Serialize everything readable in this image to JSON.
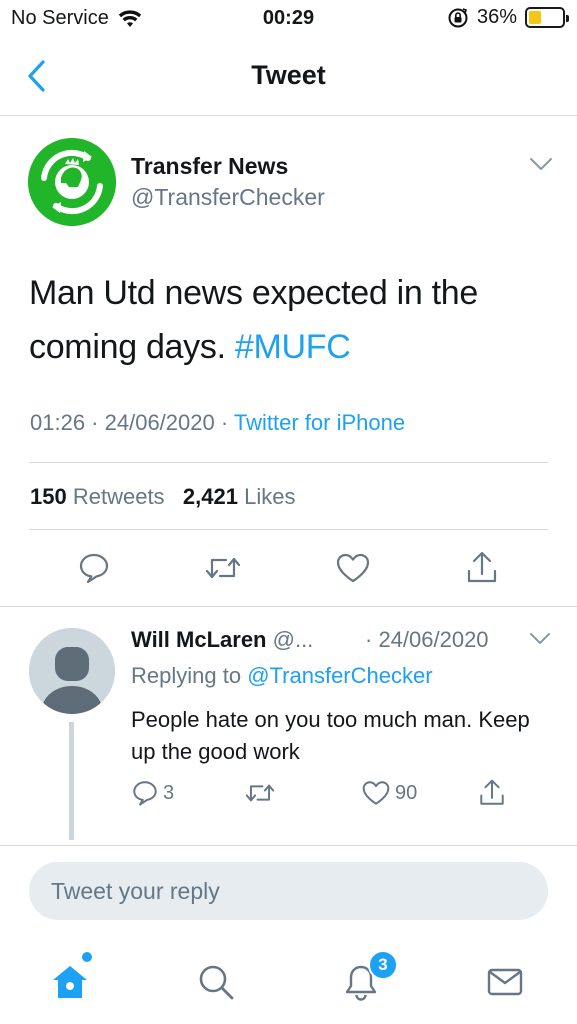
{
  "status_bar": {
    "carrier": "No Service",
    "time": "00:29",
    "battery_percent": "36%",
    "battery_level": 0.36,
    "battery_color": "#f5c518"
  },
  "nav": {
    "title": "Tweet",
    "back_icon": "chevron-left-icon"
  },
  "tweet": {
    "author_name": "Transfer News",
    "author_handle": "@TransferChecker",
    "avatar_icon": "premier-league-lion-logo",
    "text": "Man Utd news expected in the coming days.",
    "hashtag": "#MUFC",
    "time": "01:26",
    "date": "24/06/2020",
    "source": "Twitter for iPhone",
    "retweet_count": "150",
    "retweet_label": "Retweets",
    "like_count": "2,421",
    "like_label": "Likes",
    "actions": [
      "reply-icon",
      "retweet-icon",
      "like-icon",
      "share-icon"
    ]
  },
  "reply": {
    "author_name": "Will McLaren",
    "author_handle": "@...",
    "date": "· 24/06/2020",
    "replying_to_label": "Replying to",
    "replying_to_handle": "@TransferChecker",
    "text": "People hate on you too much man. Keep up the good work",
    "reply_count": "3",
    "like_count": "90"
  },
  "compose": {
    "placeholder": "Tweet your reply"
  },
  "tab_bar": {
    "tabs": [
      "home-icon",
      "search-icon",
      "notifications-icon",
      "messages-icon"
    ],
    "notification_badge": "3"
  },
  "colors": {
    "accent": "#1da1f2",
    "secondary_text": "#657786",
    "avatar_green": "#21b62a"
  }
}
